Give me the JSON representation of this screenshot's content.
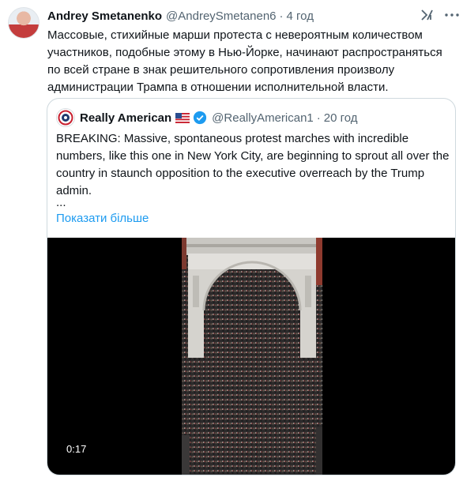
{
  "tweet": {
    "author_name": "Andrey Smetanenko",
    "author_handle": "@AndreySmetanen6",
    "separator": "·",
    "time": "4 год",
    "text": "Массовые, стихийные марши протеста с невероятным количеством участников, подобные этому в Нью-Йорке, начинают распространяться по всей стране в знак решительного сопротивления произволу администрации Трампа в отношении исполнительной власти."
  },
  "quote": {
    "author_name": "Really American",
    "author_handle": "@ReallyAmerican1",
    "separator": "·",
    "time": "20 год",
    "text": "BREAKING: Massive, spontaneous protest marches with incredible numbers, like this one in New York City, are beginning to sprout all over the country in staunch opposition to the executive overreach by the Trump admin.",
    "ellipsis": "...",
    "show_more": "Показати більше"
  },
  "video": {
    "duration": "0:17"
  },
  "icons": {
    "grok": "grok-icon",
    "more": "more-icon",
    "flag": "us-flag-icon",
    "verified": "verified-badge-icon"
  },
  "colors": {
    "link": "#1d9bf0",
    "secondary_text": "#536471",
    "verified": "#1d9bf0",
    "border": "#cfd9de"
  }
}
